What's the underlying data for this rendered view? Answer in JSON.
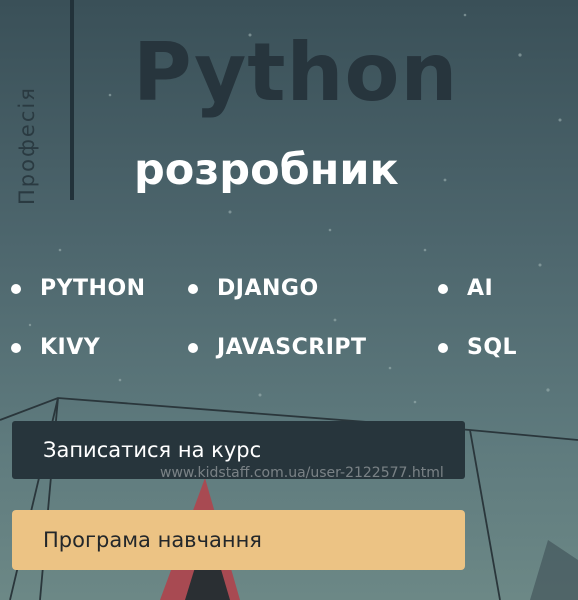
{
  "header": {
    "vertical_label": "Професія",
    "title": "Python",
    "subtitle": "розробник"
  },
  "skills": [
    {
      "label": "PYTHON"
    },
    {
      "label": "DJANGO"
    },
    {
      "label": "AI"
    },
    {
      "label": "KIVY"
    },
    {
      "label": "JAVASCRIPT"
    },
    {
      "label": "SQL"
    }
  ],
  "buttons": {
    "enroll_label": "Записатися на курс",
    "program_label": "Програма навчання"
  },
  "watermark": "www.kidstaff.com.ua/user-2122577.html",
  "colors": {
    "background": "#4d666d",
    "title_dark": "#27353d",
    "enroll_button": "#27353c",
    "program_button": "#ecc384"
  }
}
